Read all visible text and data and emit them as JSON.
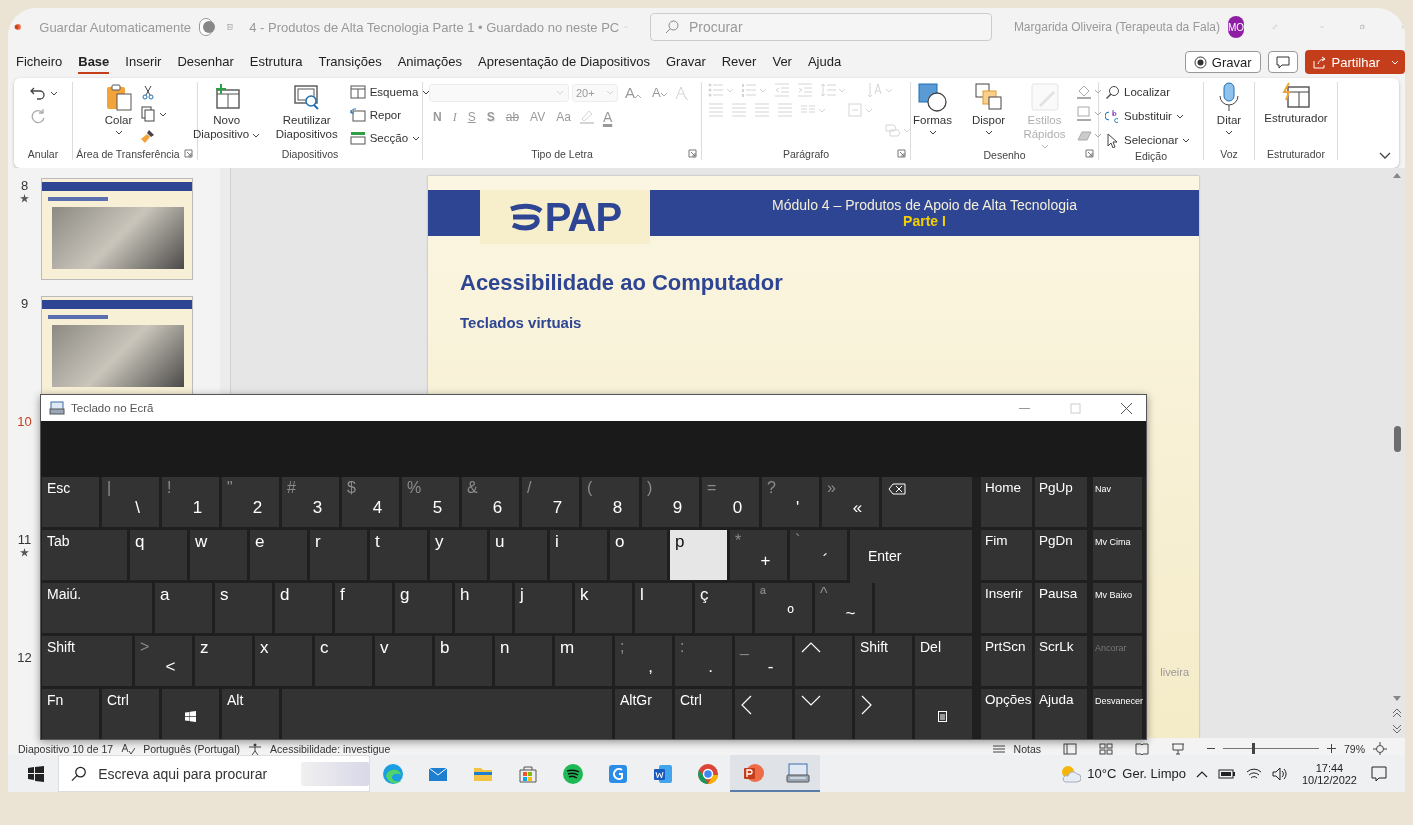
{
  "titlebar": {
    "autosave": {
      "label": "Guardar Automaticamente",
      "on": false
    },
    "document": "4 - Produtos de Alta Tecnologia Parte 1 • Guardado no neste PC",
    "search": {
      "placeholder": "Procurar"
    },
    "user": "Margarida Oliveira (Terapeuta da Fala)",
    "avatar": "MO"
  },
  "menu": [
    {
      "label": "Ficheiro",
      "selected": false
    },
    {
      "label": "Base",
      "selected": true
    },
    {
      "label": "Inserir",
      "selected": false
    },
    {
      "label": "Desenhar",
      "selected": false
    },
    {
      "label": "Estrutura",
      "selected": false
    },
    {
      "label": "Transições",
      "selected": false
    },
    {
      "label": "Animações",
      "selected": false
    },
    {
      "label": "Apresentação de Diapositivos",
      "selected": false
    },
    {
      "label": "Gravar",
      "selected": false
    },
    {
      "label": "Rever",
      "selected": false
    },
    {
      "label": "Ver",
      "selected": false
    },
    {
      "label": "Ajuda",
      "selected": false
    }
  ],
  "actions": {
    "record": "Gravar",
    "share": "Partilhar"
  },
  "ribbon": {
    "groups": [
      {
        "label": "Anular",
        "disabled": false
      },
      {
        "label": "Área de Transferência",
        "disabled": false,
        "items": [
          "Colar"
        ]
      },
      {
        "label": "Diapositivos",
        "disabled": false,
        "items": [
          "Novo Diapositivo",
          "Reutilizar Diapositivos",
          "Esquema",
          "Repor",
          "Secção"
        ]
      },
      {
        "label": "Tipo de Letra",
        "disabled": true,
        "font_size": "20+",
        "grow": "A",
        "shrink": "A",
        "format": [
          "N",
          "I",
          "S",
          "S",
          "ab",
          "AV",
          "Aa"
        ],
        "font_color": "A"
      },
      {
        "label": "Parágrafo",
        "disabled": true
      },
      {
        "label": "Desenho",
        "disabled": false,
        "items": [
          {
            "label": "Formas",
            "disabled": false
          },
          {
            "label": "Dispor",
            "disabled": false
          },
          {
            "label": "Estilos Rápidos",
            "disabled": true
          }
        ]
      },
      {
        "label": "Edição",
        "disabled": false,
        "items": [
          "Localizar",
          "Substituir",
          "Selecionar"
        ]
      },
      {
        "label": "Voz",
        "disabled": false,
        "items": [
          "Ditar"
        ]
      },
      {
        "label": "Estruturador",
        "disabled": false,
        "items": [
          "Estruturador"
        ]
      }
    ]
  },
  "slides": [
    {
      "number": "8",
      "starred": true,
      "selected": false
    },
    {
      "number": "9",
      "starred": false,
      "selected": false
    },
    {
      "number": "10",
      "starred": false,
      "selected": true
    },
    {
      "number": "11",
      "starred": true,
      "selected": false
    },
    {
      "number": "12",
      "starred": false,
      "selected": false
    }
  ],
  "slide": {
    "logo": "PAP",
    "header": "Módulo 4 – Produtos de Apoio de Alta Tecnologia",
    "part": "Parte I",
    "title": "Acessibilidade ao Computador",
    "subtitle": "Teclados virtuais",
    "footer": "liveira"
  },
  "keyboard": {
    "title": "Teclado no Ecrã",
    "rows": [
      [
        {
          "kind": "mod",
          "label": "Esc",
          "selected": false
        },
        {
          "kind": "char",
          "label": "\\",
          "shift": "|",
          "selected": false
        },
        {
          "kind": "char",
          "label": "1",
          "shift": "!",
          "selected": false
        },
        {
          "kind": "char",
          "label": "2",
          "shift": "\"",
          "selected": false
        },
        {
          "kind": "char",
          "label": "3",
          "shift": "#",
          "selected": false
        },
        {
          "kind": "char",
          "label": "4",
          "shift": "$",
          "selected": false
        },
        {
          "kind": "char",
          "label": "5",
          "shift": "%",
          "selected": false
        },
        {
          "kind": "char",
          "label": "6",
          "shift": "&",
          "selected": false
        },
        {
          "kind": "char",
          "label": "7",
          "shift": "/",
          "selected": false
        },
        {
          "kind": "char",
          "label": "8",
          "shift": "(",
          "selected": false
        },
        {
          "kind": "char",
          "label": "9",
          "shift": ")",
          "selected": false
        },
        {
          "kind": "char",
          "label": "0",
          "shift": "=",
          "selected": false
        },
        {
          "kind": "char",
          "label": "'",
          "shift": "?",
          "selected": false
        },
        {
          "kind": "char",
          "label": "«",
          "shift": "»",
          "selected": false
        },
        {
          "kind": "backspace",
          "selected": false
        }
      ],
      [
        {
          "kind": "wide",
          "label": "Tab",
          "selected": false
        },
        {
          "kind": "char",
          "label": "q",
          "selected": false
        },
        {
          "kind": "char",
          "label": "w",
          "selected": false
        },
        {
          "kind": "char",
          "label": "e",
          "selected": false
        },
        {
          "kind": "char",
          "label": "r",
          "selected": false
        },
        {
          "kind": "char",
          "label": "t",
          "selected": false
        },
        {
          "kind": "char",
          "label": "y",
          "selected": false
        },
        {
          "kind": "char",
          "label": "u",
          "selected": false
        },
        {
          "kind": "char",
          "label": "i",
          "selected": false
        },
        {
          "kind": "char",
          "label": "o",
          "selected": false
        },
        {
          "kind": "char",
          "label": "p",
          "selected": true
        },
        {
          "kind": "char",
          "label": "+",
          "shift": "*",
          "selected": false
        },
        {
          "kind": "char",
          "label": "´",
          "shift": "`",
          "selected": false
        },
        {
          "kind": "enter",
          "label": "Enter",
          "selected": false
        }
      ],
      [
        {
          "kind": "wide",
          "label": "Maiú.",
          "selected": false
        },
        {
          "kind": "char",
          "label": "a",
          "selected": false
        },
        {
          "kind": "char",
          "label": "s",
          "selected": false
        },
        {
          "kind": "char",
          "label": "d",
          "selected": false
        },
        {
          "kind": "char",
          "label": "f",
          "selected": false
        },
        {
          "kind": "char",
          "label": "g",
          "selected": false
        },
        {
          "kind": "char",
          "label": "h",
          "selected": false
        },
        {
          "kind": "char",
          "label": "j",
          "selected": false
        },
        {
          "kind": "char",
          "label": "k",
          "selected": false
        },
        {
          "kind": "char",
          "label": "l",
          "selected": false
        },
        {
          "kind": "char",
          "label": "ç",
          "selected": false
        },
        {
          "kind": "char",
          "label": "º",
          "shift": "ª",
          "selected": false
        },
        {
          "kind": "char",
          "label": "~",
          "shift": "^",
          "selected": false
        }
      ],
      [
        {
          "kind": "wide",
          "label": "Shift",
          "selected": false
        },
        {
          "kind": "char",
          "label": "<",
          "shift": ">",
          "selected": false
        },
        {
          "kind": "char",
          "label": "z",
          "selected": false
        },
        {
          "kind": "char",
          "label": "x",
          "selected": false
        },
        {
          "kind": "char",
          "label": "c",
          "selected": false
        },
        {
          "kind": "char",
          "label": "v",
          "selected": false
        },
        {
          "kind": "char",
          "label": "b",
          "selected": false
        },
        {
          "kind": "char",
          "label": "n",
          "selected": false
        },
        {
          "kind": "char",
          "label": "m",
          "selected": false
        },
        {
          "kind": "char",
          "label": ",",
          "shift": ";",
          "selected": false
        },
        {
          "kind": "char",
          "label": ".",
          "shift": ":",
          "selected": false
        },
        {
          "kind": "char",
          "label": "-",
          "shift": "_",
          "selected": false
        },
        {
          "kind": "up",
          "selected": false
        },
        {
          "kind": "mod",
          "label": "Shift",
          "selected": false
        },
        {
          "kind": "mod",
          "label": "Del",
          "selected": false
        }
      ],
      [
        {
          "kind": "mod",
          "label": "Fn",
          "selected": false
        },
        {
          "kind": "mod",
          "label": "Ctrl",
          "selected": false
        },
        {
          "kind": "win",
          "selected": false
        },
        {
          "kind": "mod",
          "label": "Alt",
          "selected": false
        },
        {
          "kind": "space",
          "selected": false
        },
        {
          "kind": "mod",
          "label": "AltGr",
          "selected": false
        },
        {
          "kind": "mod",
          "label": "Ctrl",
          "selected": false
        },
        {
          "kind": "left",
          "selected": false
        },
        {
          "kind": "down",
          "selected": false
        },
        {
          "kind": "right",
          "selected": false
        },
        {
          "kind": "menu",
          "selected": false
        }
      ]
    ],
    "nav": [
      {
        "label": "Home",
        "disabled": false
      },
      {
        "label": "PgUp",
        "disabled": false
      },
      {
        "label": "Nav",
        "disabled": false
      },
      {
        "label": "Fim",
        "disabled": false
      },
      {
        "label": "PgDn",
        "disabled": false
      },
      {
        "label": "Mv Cima",
        "disabled": false
      },
      {
        "label": "Inserir",
        "disabled": false
      },
      {
        "label": "Pausa",
        "disabled": false
      },
      {
        "label": "Mv Baixo",
        "disabled": false
      },
      {
        "label": "PrtScn",
        "disabled": false
      },
      {
        "label": "ScrLk",
        "disabled": false
      },
      {
        "label": "Ancorar",
        "disabled": true
      },
      {
        "label": "Opções",
        "disabled": false
      },
      {
        "label": "Ajuda",
        "disabled": false
      },
      {
        "label": "Desvanecer",
        "disabled": false
      }
    ]
  },
  "status": {
    "position": "Diapositivo 10 de 17",
    "language": "Português (Portugal)",
    "accessibility": "Acessibilidade: investigue",
    "notes": "Notas",
    "zoom": {
      "level": 0.3
    },
    "zoom_text": "79%"
  },
  "taskbar": {
    "search": {
      "placeholder": "Escreva aqui para procurar"
    },
    "apps": [
      {
        "kind": "browser",
        "active": false
      },
      {
        "kind": "mail",
        "active": false
      },
      {
        "kind": "folder",
        "active": false
      },
      {
        "kind": "store",
        "active": false
      },
      {
        "kind": "music",
        "active": false
      },
      {
        "kind": "gapp",
        "active": false
      },
      {
        "kind": "word",
        "active": false
      },
      {
        "kind": "chrome",
        "active": false
      },
      {
        "kind": "slides",
        "active": true
      },
      {
        "kind": "keyboard",
        "active": true
      }
    ],
    "temperature": "10°C",
    "weather": "Ger. Limpo",
    "time": "17:44",
    "date": "10/12/2022"
  }
}
